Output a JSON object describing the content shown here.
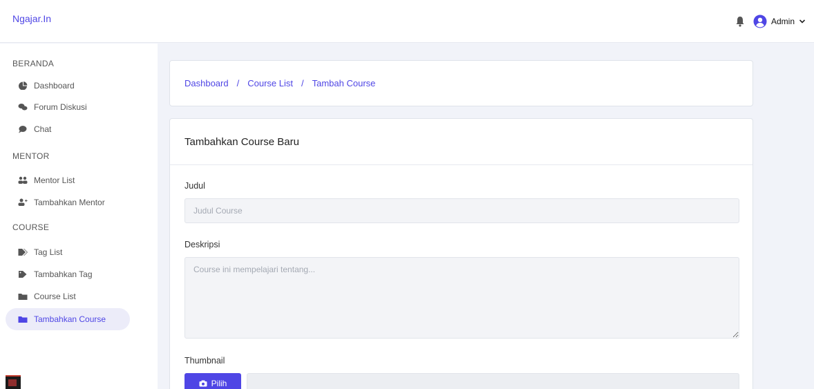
{
  "topbar": {
    "brand": "Ngajar.In",
    "user_name": "Admin"
  },
  "sidebar": {
    "sections": [
      {
        "title": "BERANDA",
        "items": [
          {
            "label": "Dashboard",
            "icon": "dashboard-icon"
          },
          {
            "label": "Forum Diskusi",
            "icon": "comments-icon"
          },
          {
            "label": "Chat",
            "icon": "chat-icon"
          }
        ]
      },
      {
        "title": "MENTOR",
        "items": [
          {
            "label": "Mentor List",
            "icon": "users-icon"
          },
          {
            "label": "Tambahkan Mentor",
            "icon": "user-plus-icon"
          }
        ]
      },
      {
        "title": "COURSE",
        "items": [
          {
            "label": "Tag List",
            "icon": "tags-icon"
          },
          {
            "label": "Tambahkan Tag",
            "icon": "tag-icon"
          },
          {
            "label": "Course List",
            "icon": "folder-icon"
          },
          {
            "label": "Tambahkan Course",
            "icon": "folder-plus-icon",
            "active": true
          }
        ]
      }
    ]
  },
  "breadcrumb": {
    "items": [
      "Dashboard",
      "Course List",
      "Tambah Course"
    ],
    "separator": "/"
  },
  "form": {
    "title": "Tambahkan Course Baru",
    "judul_label": "Judul",
    "judul_placeholder": "Judul Course",
    "deskripsi_label": "Deskripsi",
    "deskripsi_placeholder": "Course ini mempelajari tentang...",
    "thumbnail_label": "Thumbnail",
    "pick_button": "Pilih"
  },
  "colors": {
    "accent": "#4f46e5",
    "active_bg": "#ececf9"
  }
}
